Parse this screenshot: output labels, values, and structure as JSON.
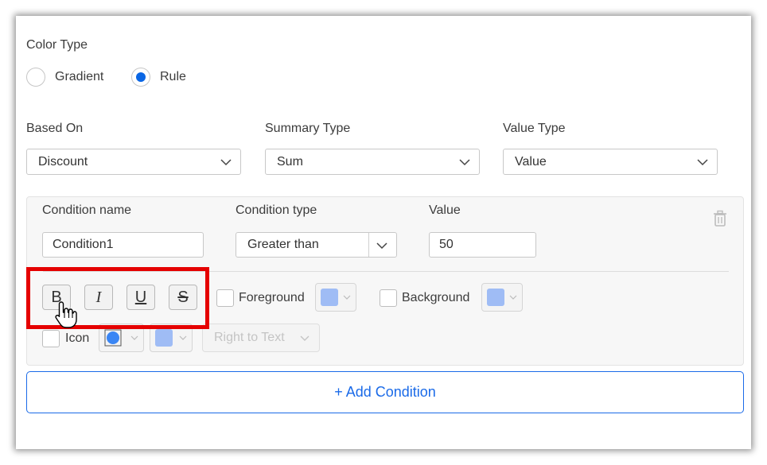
{
  "color_type": {
    "label": "Color Type",
    "options": [
      {
        "label": "Gradient",
        "selected": false
      },
      {
        "label": "Rule",
        "selected": true
      }
    ]
  },
  "based_on": {
    "label": "Based On",
    "value": "Discount"
  },
  "summary_type": {
    "label": "Summary Type",
    "value": "Sum"
  },
  "value_type": {
    "label": "Value Type",
    "value": "Value"
  },
  "condition": {
    "name_label": "Condition name",
    "type_label": "Condition type",
    "value_label": "Value",
    "name_value": "Condition1",
    "type_value": "Greater than",
    "value_value": "50",
    "format_buttons": {
      "bold": "B",
      "italic": "I",
      "underline": "U",
      "strike": "S"
    },
    "foreground_label": "Foreground",
    "background_label": "Background",
    "icon_label": "Icon",
    "icon_position": "Right to Text",
    "swatch_color": "#9fbcf5",
    "icon_color": "#3a86f4"
  },
  "add_condition_label": "+ Add Condition",
  "colors": {
    "accent": "#1a6ae8",
    "highlight": "#e50000"
  }
}
